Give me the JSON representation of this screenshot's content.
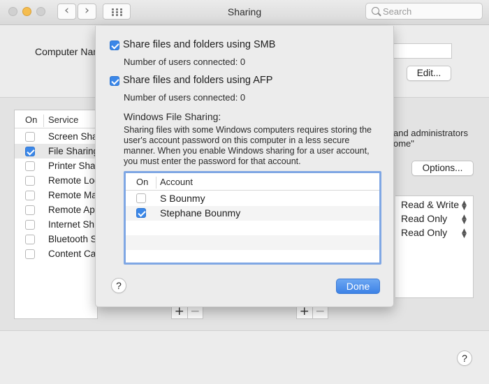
{
  "window": {
    "title": "Sharing",
    "search_placeholder": "Search",
    "back_glyph": "‹",
    "forward_glyph": "›"
  },
  "background": {
    "computer_name_label": "Computer Nam",
    "edit_label": "Edit...",
    "options_label": "Options...",
    "services_header": {
      "on": "On",
      "service": "Service"
    },
    "services": [
      {
        "label": "Screen Sha",
        "checked": false
      },
      {
        "label": "File Sharing",
        "checked": true,
        "selected": true
      },
      {
        "label": "Printer Sha",
        "checked": false
      },
      {
        "label": "Remote Log",
        "checked": false
      },
      {
        "label": "Remote Ma",
        "checked": false
      },
      {
        "label": "Remote App",
        "checked": false
      },
      {
        "label": "Internet Sh",
        "checked": false
      },
      {
        "label": "Bluetooth S",
        "checked": false
      },
      {
        "label": "Content Ca",
        "checked": false
      }
    ],
    "note_line1": "and administrators",
    "note_line2": "ome\"",
    "permissions": [
      "Read & Write",
      "Read Only",
      "Read Only"
    ],
    "plus": "+",
    "minus": "−",
    "help": "?"
  },
  "sheet": {
    "smb_label": "Share files and folders using SMB",
    "smb_checked": true,
    "smb_users": "Number of users connected: 0",
    "afp_label": "Share files and folders using AFP",
    "afp_checked": true,
    "afp_users": "Number of users connected: 0",
    "windows_heading": "Windows File Sharing:",
    "windows_desc": "Sharing files with some Windows computers requires storing the user's account password on this computer in a less secure manner. When you enable Windows sharing for a user account, you must enter the password for that account.",
    "accounts_header": {
      "on": "On",
      "account": "Account"
    },
    "accounts": [
      {
        "name": "S Bounmy",
        "checked": false
      },
      {
        "name": "Stephane Bounmy",
        "checked": true
      }
    ],
    "help": "?",
    "done_label": "Done"
  },
  "colors": {
    "accent": "#3b87e8",
    "focus_ring": "#7fa7e4"
  }
}
